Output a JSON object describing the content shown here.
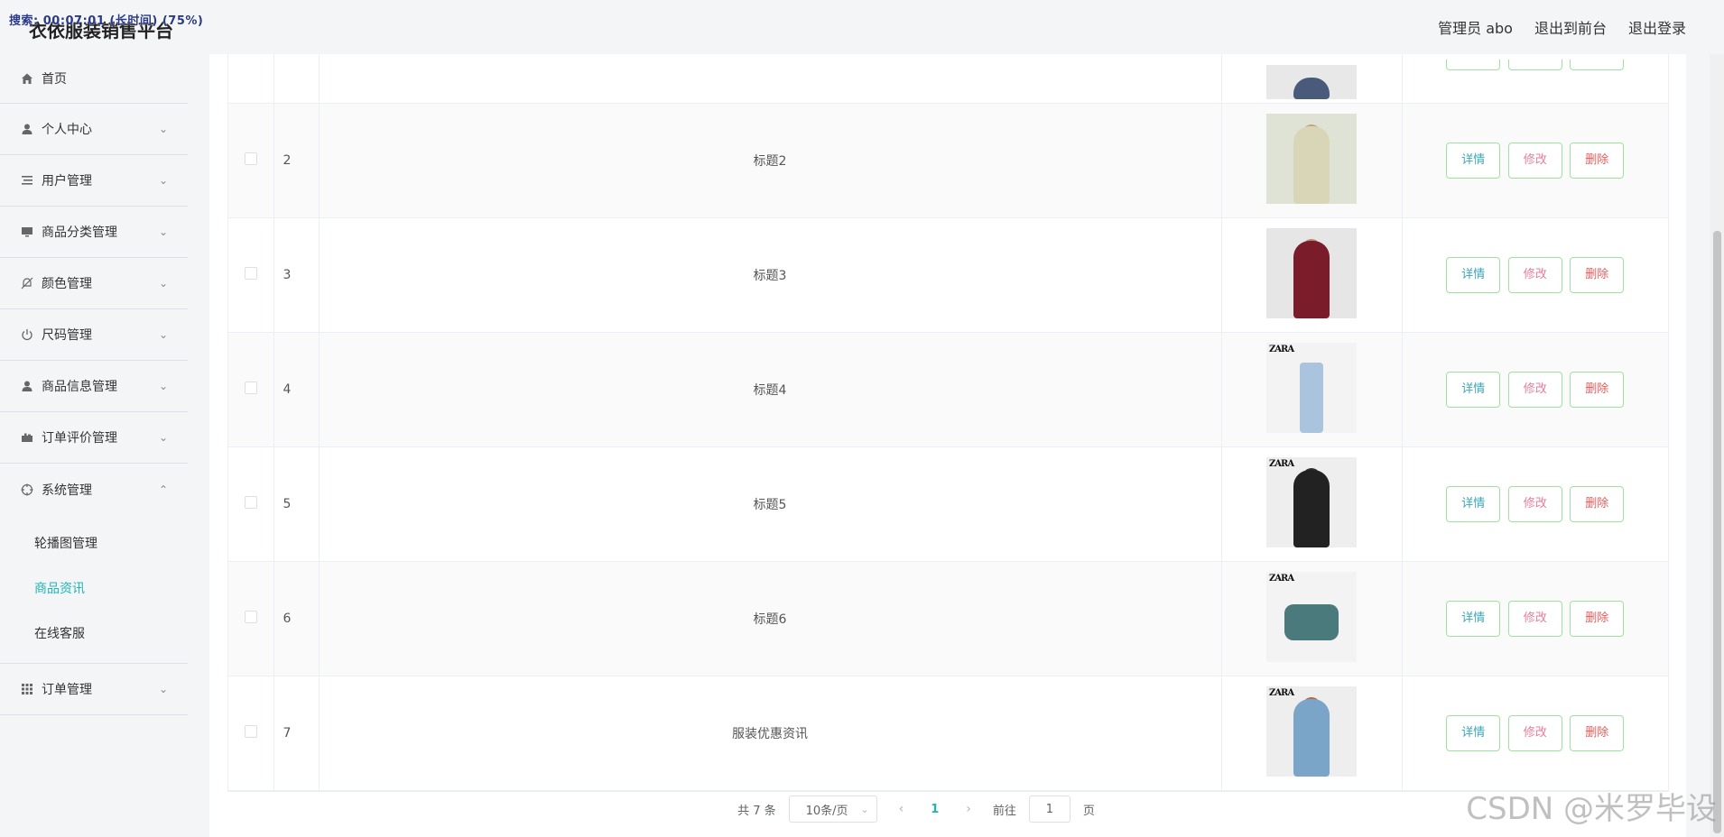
{
  "recorder": "搜索: 00:07:01 (长时间) (75%)",
  "header": {
    "brand": "衣依服装销售平台",
    "admin_label": "管理员 abo",
    "front_link": "退出到前台",
    "logout_link": "退出登录"
  },
  "sidebar": {
    "items": [
      {
        "label": "首页",
        "icon": "home-icon"
      },
      {
        "label": "个人中心",
        "icon": "user-icon"
      },
      {
        "label": "用户管理",
        "icon": "list-icon"
      },
      {
        "label": "商品分类管理",
        "icon": "monitor-icon"
      },
      {
        "label": "颜色管理",
        "icon": "bell-off-icon"
      },
      {
        "label": "尺码管理",
        "icon": "power-icon"
      },
      {
        "label": "商品信息管理",
        "icon": "user-icon"
      },
      {
        "label": "订单评价管理",
        "icon": "suitcase-icon"
      },
      {
        "label": "系统管理",
        "icon": "crosshair-icon"
      },
      {
        "label": "订单管理",
        "icon": "grid-icon"
      }
    ],
    "system_sub": [
      {
        "label": "轮播图管理"
      },
      {
        "label": "商品资讯"
      },
      {
        "label": "在线客服"
      }
    ]
  },
  "table": {
    "rows": [
      {
        "index": "",
        "title": ""
      },
      {
        "index": "2",
        "title": "标题2"
      },
      {
        "index": "3",
        "title": "标题3"
      },
      {
        "index": "4",
        "title": "标题4"
      },
      {
        "index": "5",
        "title": "标题5"
      },
      {
        "index": "6",
        "title": "标题6"
      },
      {
        "index": "7",
        "title": "服装优惠资讯"
      }
    ],
    "buttons": {
      "detail": "详情",
      "edit": "修改",
      "delete": "删除"
    },
    "brand_tag": "ZARA"
  },
  "pagination": {
    "total": "共 7 条",
    "page_size": "10条/页",
    "current": "1",
    "goto_label": "前往",
    "goto_value": "1",
    "page_suffix": "页"
  },
  "watermark": "CSDN @米罗毕设",
  "colors": {
    "accent": "#1fb5b5",
    "detail": "#3aa7b8",
    "edit": "#e87c9b",
    "delete": "#e65b5b"
  }
}
